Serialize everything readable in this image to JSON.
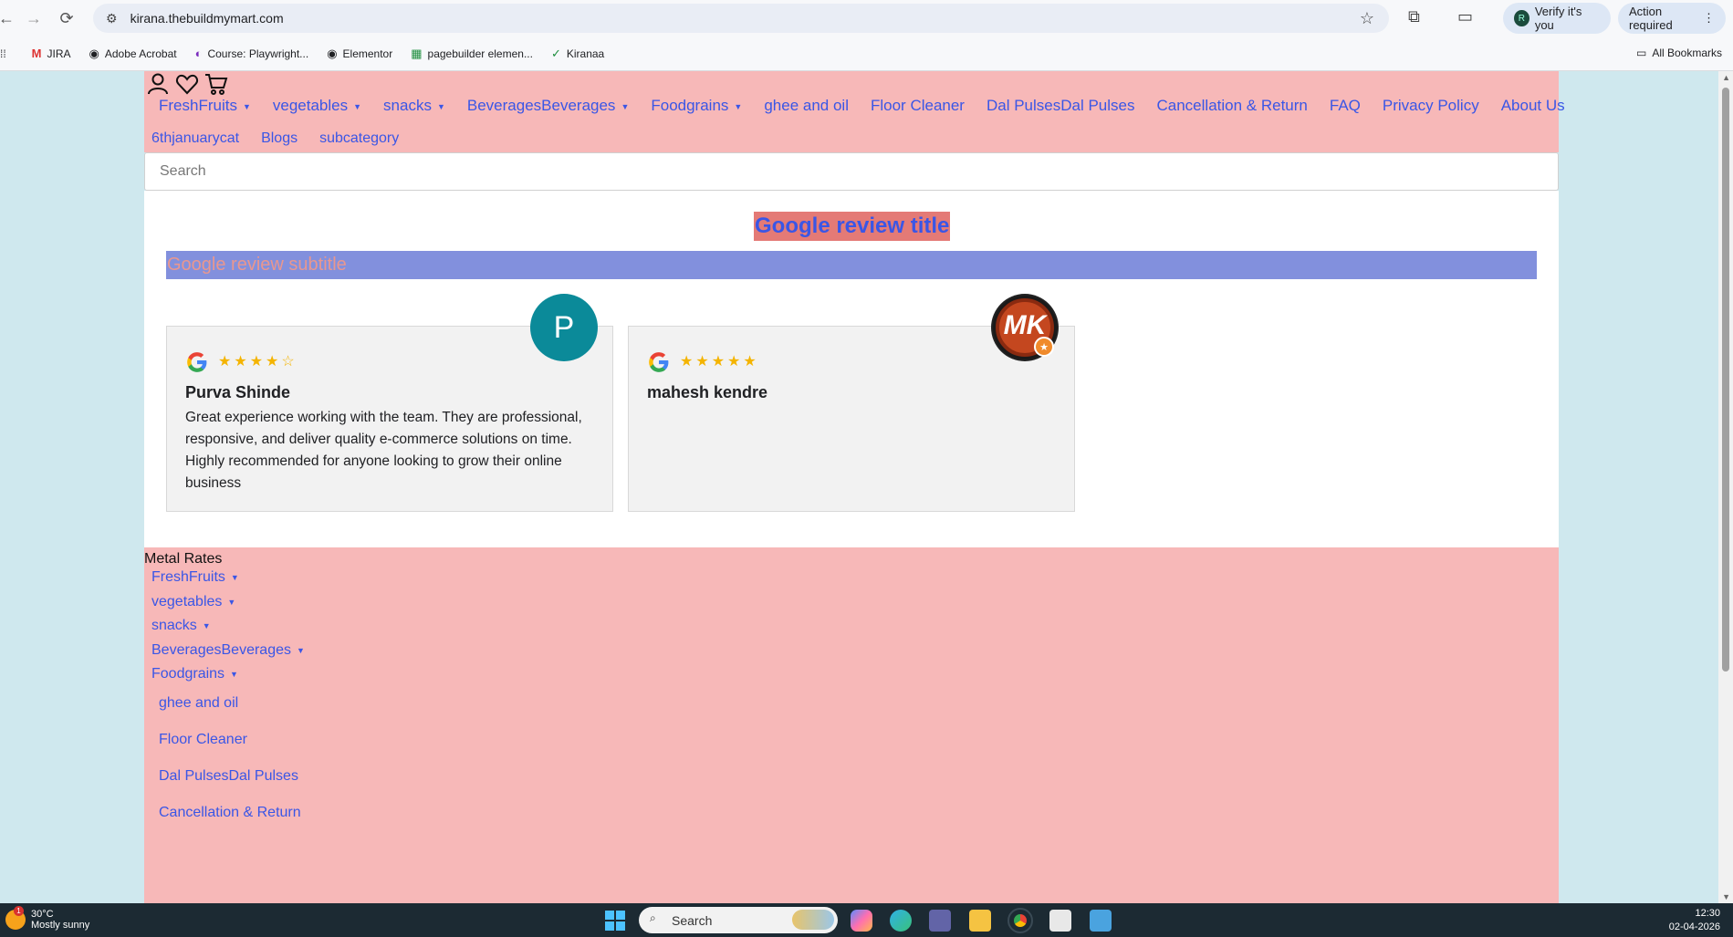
{
  "browser": {
    "url": "kirana.thebuildmymart.com",
    "verify_label": "Verify it's you",
    "action_label": "Action required",
    "bookmarks": [
      "JIRA",
      "Adobe Acrobat",
      "Course: Playwright...",
      "Elementor",
      "pagebuilder elemen...",
      "Kiranaa"
    ],
    "all_bookmarks": "All Bookmarks"
  },
  "header": {
    "menu_row1": [
      {
        "label": "FreshFruits",
        "dropdown": true
      },
      {
        "label": "vegetables",
        "dropdown": true
      },
      {
        "label": "snacks",
        "dropdown": true
      },
      {
        "label": "BeveragesBeverages",
        "dropdown": true
      },
      {
        "label": "Foodgrains",
        "dropdown": true
      },
      {
        "label": "ghee and oil",
        "dropdown": false
      },
      {
        "label": "Floor Cleaner",
        "dropdown": false
      },
      {
        "label": "Dal PulsesDal Pulses",
        "dropdown": false
      },
      {
        "label": "Cancellation & Return",
        "dropdown": false
      },
      {
        "label": "FAQ",
        "dropdown": false
      },
      {
        "label": "Privacy Policy",
        "dropdown": false
      },
      {
        "label": "About Us",
        "dropdown": false
      }
    ],
    "menu_row2": [
      "6thjanuarycat",
      "Blogs",
      "subcategory"
    ]
  },
  "search": {
    "placeholder": "Search"
  },
  "reviews": {
    "title": "Google review title",
    "subtitle": "Google review subtitle",
    "items": [
      {
        "name": "Purva Shinde",
        "rating": 4,
        "stars": "★★★★☆",
        "avatar_letter": "P",
        "text": "Great experience working with the team. They are professional, responsive, and deliver quality e-commerce solutions on time. Highly recommended for anyone looking to grow their online business"
      },
      {
        "name": "mahesh kendre",
        "rating": 5,
        "stars": "★★★★★",
        "avatar_letter": "MK",
        "text": ""
      }
    ]
  },
  "footer": {
    "heading": "Metal Rates",
    "links": [
      {
        "label": "FreshFruits",
        "dropdown": true
      },
      {
        "label": "vegetables",
        "dropdown": true
      },
      {
        "label": "snacks",
        "dropdown": true
      },
      {
        "label": "BeveragesBeverages",
        "dropdown": true
      },
      {
        "label": "Foodgrains",
        "dropdown": true
      },
      {
        "label": "ghee and oil",
        "dropdown": false
      },
      {
        "label": "Floor Cleaner",
        "dropdown": false
      },
      {
        "label": "Dal PulsesDal Pulses",
        "dropdown": false
      },
      {
        "label": "Cancellation & Return",
        "dropdown": false
      }
    ]
  },
  "taskbar": {
    "temperature": "30°C",
    "weather": "Mostly sunny",
    "weather_badge": "1",
    "search_label": "Search",
    "time": "12:30",
    "date": "02-04-2026"
  },
  "colors": {
    "link": "#3a56e6",
    "header_bg": "#f7b8b8",
    "title_bg": "#e47a76",
    "subtitle_bg": "#8290dd",
    "star": "#f4b400",
    "annotation_arrow": "#7cc8ee"
  }
}
